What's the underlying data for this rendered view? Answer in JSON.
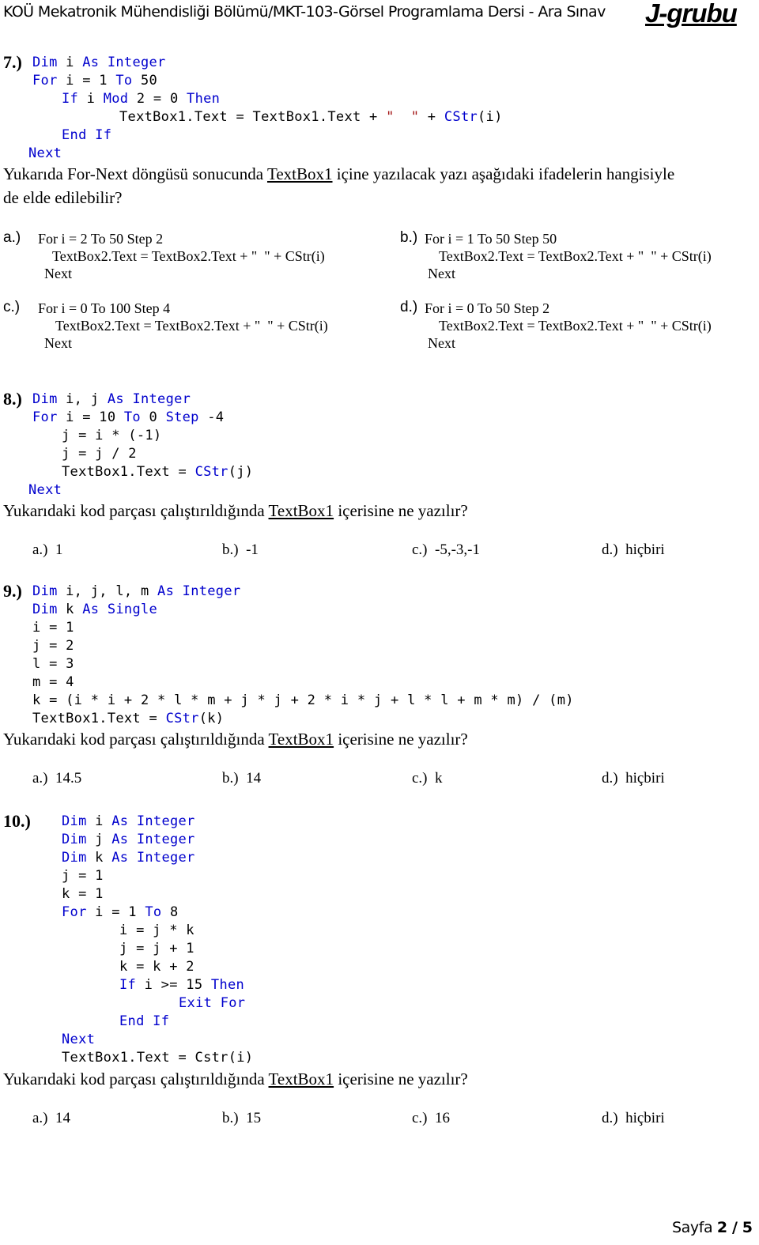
{
  "header": {
    "title": "KOÜ Mekatronik Mühendisliği Bölümü/MKT-103-Görsel Programlama Dersi - Ara Sınav",
    "group": "J-grubu"
  },
  "q7": {
    "number": "7.)",
    "code": {
      "l1": [
        "Dim",
        " i ",
        "As",
        " ",
        "Integer"
      ],
      "l2": [
        "For",
        " i = 1 ",
        "To",
        " 50"
      ],
      "l3": [
        "If",
        " i ",
        "Mod",
        " 2 = 0 ",
        "Then"
      ],
      "l4": [
        "TextBox1.Text = TextBox1.Text + ",
        "\"  \"",
        " + ",
        "CStr",
        "(i)"
      ],
      "l5": [
        "End",
        " ",
        "If"
      ],
      "l6": [
        "Next"
      ]
    },
    "question_part1": "Yukarıda For-Next döngüsü sonucunda ",
    "question_link": "TextBox1",
    "question_part2": " içine yazılacak yazı aşağıdaki ifadelerin hangisiyle",
    "question_line2": "de elde edilebilir?",
    "options": [
      {
        "label": "a.)",
        "l1": "For i = 2 To 50 Step 2",
        "l2": "TextBox2.Text = TextBox2.Text + \"  \" + CStr(i)",
        "l3": "Next"
      },
      {
        "label": "b.)",
        "l1": "For i = 1 To 50 Step 50",
        "l2": "TextBox2.Text = TextBox2.Text + \"  \" + CStr(i)",
        "l3": "Next"
      },
      {
        "label": "c.)",
        "l1": "For i = 0 To 100 Step 4",
        "l2": "TextBox2.Text = TextBox2.Text + \"  \" + CStr(i)",
        "l3": "Next"
      },
      {
        "label": "d.)",
        "l1": "For i = 0 To 50 Step 2",
        "l2": "TextBox2.Text = TextBox2.Text + \"  \" + CStr(i)",
        "l3": "Next"
      }
    ]
  },
  "q8": {
    "number": "8.)",
    "code": {
      "l1": [
        "Dim",
        " i, j ",
        "As",
        " ",
        "Integer"
      ],
      "l2": [
        "For",
        " i = 10 ",
        "To",
        " 0 ",
        "Step",
        " -4"
      ],
      "l3": "j = i * (-1)",
      "l4": "j = j / 2",
      "l5": [
        "TextBox1.Text = ",
        "CStr",
        "(j)"
      ],
      "l6": [
        "Next"
      ]
    },
    "question_part1": "Yukarıdaki kod parçası çalıştırıldığında ",
    "question_link": "TextBox1",
    "question_part2": " içerisine ne yazılır?",
    "answers": [
      {
        "label": "a.)",
        "value": "1"
      },
      {
        "label": "b.)",
        "value": "-1"
      },
      {
        "label": "c.)",
        "value": "-5,-3,-1"
      },
      {
        "label": "d.)",
        "value": "hiçbiri"
      }
    ]
  },
  "q9": {
    "number": "9.)",
    "code": {
      "l1": [
        "Dim",
        " i, j, l, m ",
        "As",
        " ",
        "Integer"
      ],
      "l2": [
        "Dim",
        " k ",
        "As",
        " ",
        "Single"
      ],
      "l3": "i = 1",
      "l4": "j = 2",
      "l5": "l = 3",
      "l6": "m = 4",
      "l7": "k = (i * i + 2 * l * m + j * j + 2 * i * j + l * l + m * m) / (m)",
      "l8": [
        "TextBox1.Text = ",
        "CStr",
        "(k)"
      ]
    },
    "question_part1": "Yukarıdaki kod parçası çalıştırıldığında ",
    "question_link": "TextBox1",
    "question_part2": " içerisine ne yazılır?",
    "answers": [
      {
        "label": "a.)",
        "value": "14.5"
      },
      {
        "label": "b.)",
        "value": "14"
      },
      {
        "label": "c.)",
        "value": "k"
      },
      {
        "label": "d.)",
        "value": "hiçbiri"
      }
    ]
  },
  "q10": {
    "number": "10.)",
    "code": {
      "l1": [
        "Dim",
        " i ",
        "As",
        " ",
        "Integer"
      ],
      "l2": [
        "Dim",
        " j ",
        "As",
        " ",
        "Integer"
      ],
      "l3": [
        "Dim",
        " k ",
        "As",
        " ",
        "Integer"
      ],
      "l4": "j = 1",
      "l5": "k = 1",
      "l6": [
        "For",
        " i = 1 ",
        "To",
        " 8"
      ],
      "l7": "i = j * k",
      "l8": "j = j + 1",
      "l9": "k = k + 2",
      "l10": [
        "If",
        " i >= 15 ",
        "Then"
      ],
      "l11": [
        "Exit",
        " ",
        "For"
      ],
      "l12": [
        "End",
        " ",
        "If"
      ],
      "l13": [
        "Next"
      ],
      "l14": "TextBox1.Text = Cstr(i)"
    },
    "question_part1": "Yukarıdaki kod parçası çalıştırıldığında ",
    "question_link": "TextBox1",
    "question_part2": " içerisine ne yazılır?",
    "answers": [
      {
        "label": "a.)",
        "value": "14"
      },
      {
        "label": "b.)",
        "value": "15"
      },
      {
        "label": "c.)",
        "value": "16"
      },
      {
        "label": "d.)",
        "value": "hiçbiri"
      }
    ]
  },
  "footer": {
    "page_label": "Sayfa",
    "page_current": "2",
    "separator": "/",
    "page_total": "5"
  }
}
